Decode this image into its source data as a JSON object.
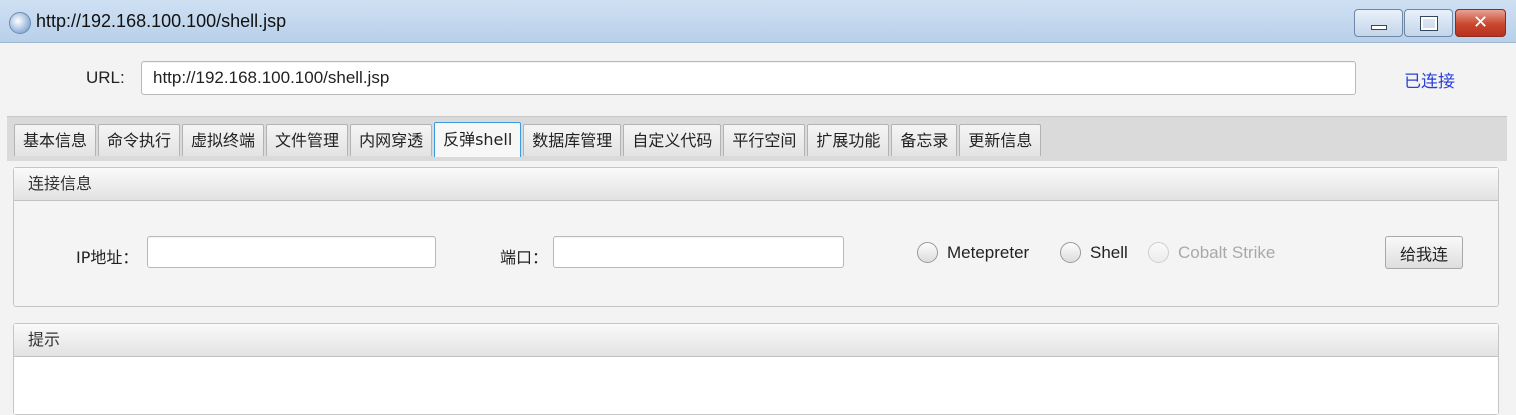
{
  "window": {
    "title": "http://192.168.100.100/shell.jsp",
    "app_icon": "globe-icon",
    "controls": {
      "minimize": "minimize-icon",
      "maximize": "maximize-icon",
      "close": "close-icon",
      "close_glyph": "✕"
    }
  },
  "url_bar": {
    "label": "URL:",
    "value": "http://192.168.100.100/shell.jsp",
    "status": "已连接",
    "status_color": "#2a3fd6"
  },
  "tabs": [
    {
      "label": "基本信息"
    },
    {
      "label": "命令执行"
    },
    {
      "label": "虚拟终端"
    },
    {
      "label": "文件管理"
    },
    {
      "label": "内网穿透"
    },
    {
      "label": "反弹shell",
      "active": true
    },
    {
      "label": "数据库管理"
    },
    {
      "label": "自定义代码"
    },
    {
      "label": "平行空间"
    },
    {
      "label": "扩展功能"
    },
    {
      "label": "备忘录"
    },
    {
      "label": "更新信息"
    }
  ],
  "connection_panel": {
    "title": "连接信息",
    "ip_label": "IP地址：",
    "ip_value": "",
    "port_label": "端口：",
    "port_value": "",
    "radios": [
      {
        "label": "Metepreter",
        "selected": false,
        "enabled": true
      },
      {
        "label": "Shell",
        "selected": false,
        "enabled": true
      },
      {
        "label": "Cobalt Strike",
        "selected": false,
        "enabled": false
      }
    ],
    "button": "给我连"
  },
  "hint_panel": {
    "title": "提示"
  },
  "colors": {
    "accent_tab_border": "#3c9be0",
    "close_button": "#c9462f"
  }
}
